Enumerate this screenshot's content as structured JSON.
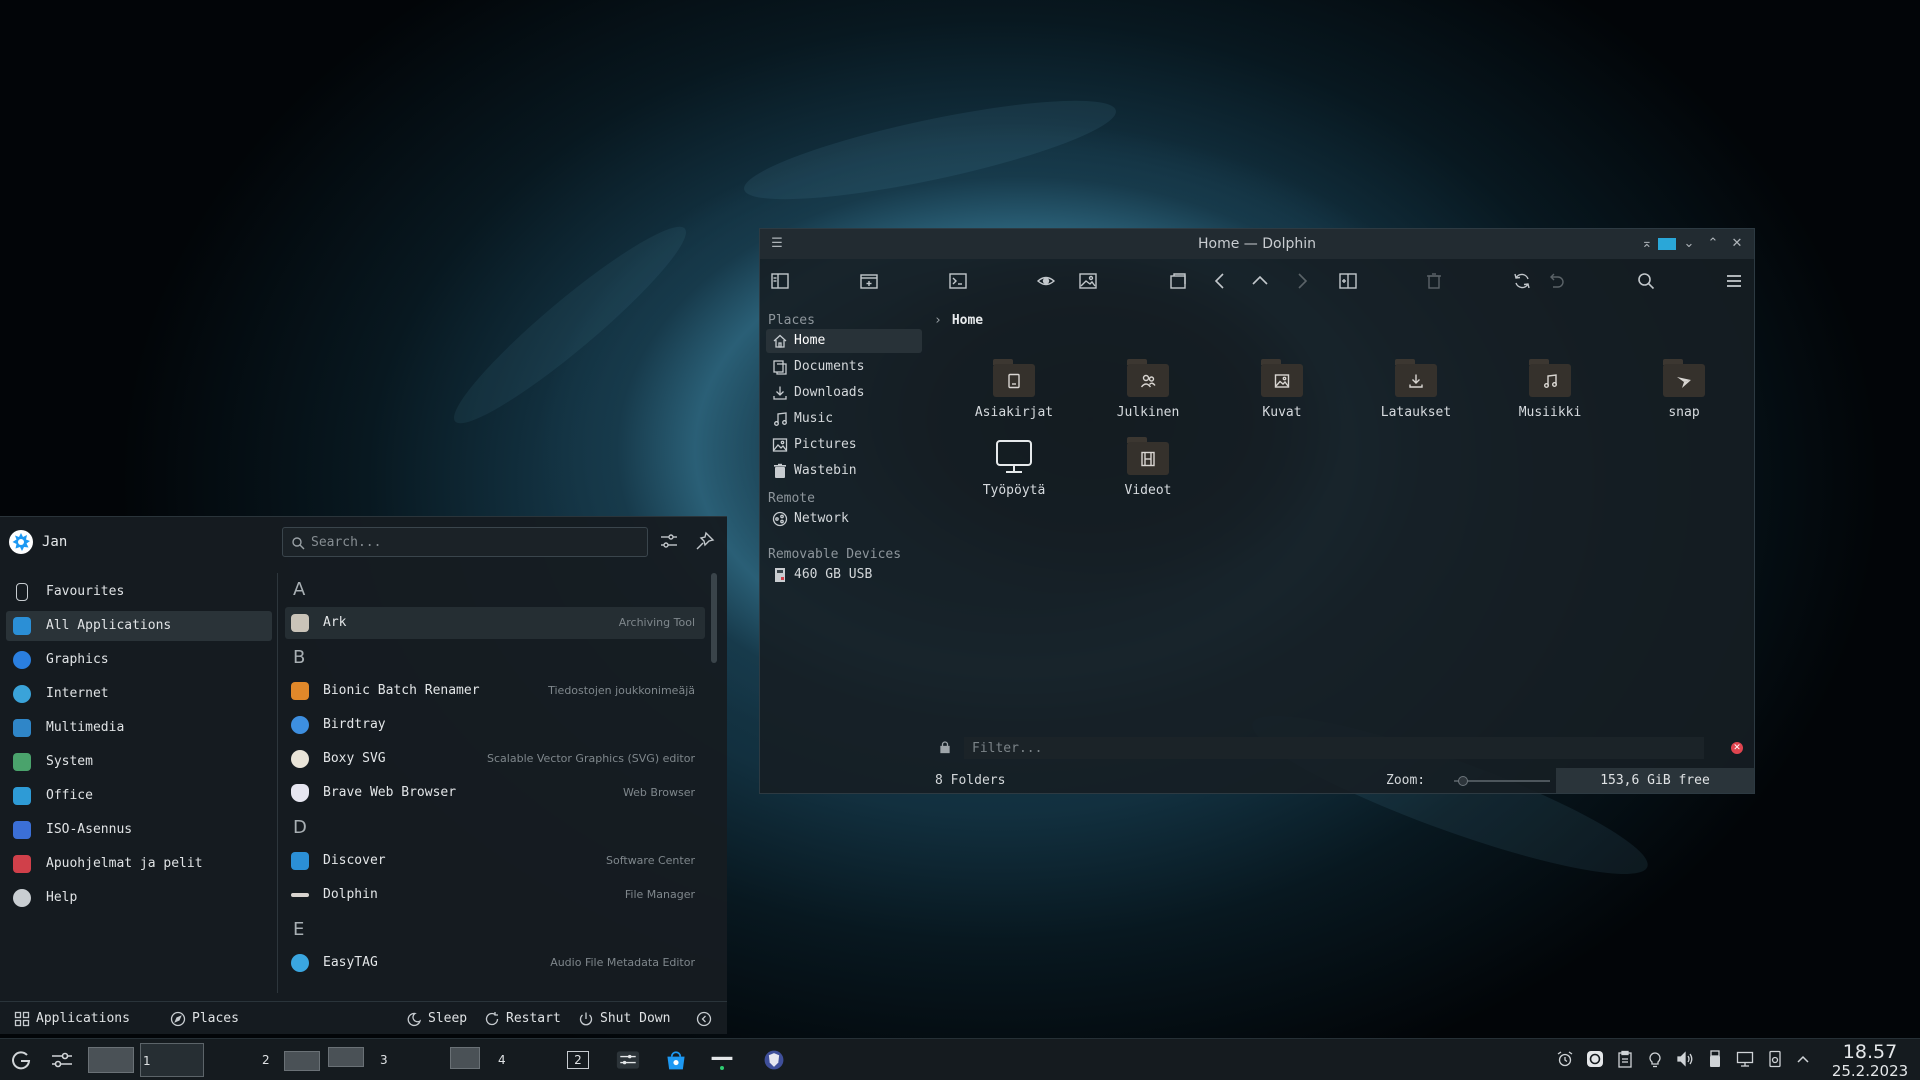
{
  "dolphin": {
    "title": "Home — Dolphin",
    "breadcrumb": "Home",
    "places_heading": "Places",
    "places": [
      {
        "label": "Home",
        "icon": "home-icon",
        "active": true
      },
      {
        "label": "Documents",
        "icon": "document-icon"
      },
      {
        "label": "Downloads",
        "icon": "download-icon"
      },
      {
        "label": "Music",
        "icon": "music-icon"
      },
      {
        "label": "Pictures",
        "icon": "image-icon"
      },
      {
        "label": "Wastebin",
        "icon": "trash-icon"
      }
    ],
    "remote_heading": "Remote",
    "remote": [
      {
        "label": "Network",
        "icon": "network-icon"
      }
    ],
    "removable_heading": "Removable Devices",
    "removable": [
      {
        "label": "460 GB USB",
        "icon": "usb-drive-icon"
      }
    ],
    "folders": [
      {
        "name": "Asiakirjat",
        "icon": "document-icon"
      },
      {
        "name": "Julkinen",
        "icon": "people-icon"
      },
      {
        "name": "Kuvat",
        "icon": "image-icon"
      },
      {
        "name": "Lataukset",
        "icon": "download-icon"
      },
      {
        "name": "Musiikki",
        "icon": "music-icon"
      },
      {
        "name": "snap",
        "icon": "snap-icon"
      },
      {
        "name": "Työpöytä",
        "icon": "monitor-icon"
      },
      {
        "name": "Videot",
        "icon": "video-icon"
      }
    ],
    "filter_placeholder": "Filter...",
    "status_count": "8 Folders",
    "zoom_label": "Zoom:",
    "zoom_level": 0.05,
    "free_space": "153,6 GiB free"
  },
  "launcher": {
    "user": "Jan",
    "search_placeholder": "Search...",
    "categories": [
      {
        "label": "Favourites",
        "icon": "bookmark-icon",
        "color": "#3b4449"
      },
      {
        "label": "All Applications",
        "icon": "grid-icon",
        "color": "#2b8fd6",
        "active": true
      },
      {
        "label": "Graphics",
        "icon": "graphics-icon",
        "color": "#2a7fe0"
      },
      {
        "label": "Internet",
        "icon": "globe-icon",
        "color": "#3aa3d9"
      },
      {
        "label": "Multimedia",
        "icon": "multimedia-icon",
        "color": "#2f86c8"
      },
      {
        "label": "System",
        "icon": "system-icon",
        "color": "#4aa36c"
      },
      {
        "label": "Office",
        "icon": "office-icon",
        "color": "#2e9bd6"
      },
      {
        "label": "ISO-Asennus",
        "icon": "installer-icon",
        "color": "#3b6fd6"
      },
      {
        "label": "Apuohjelmat ja pelit",
        "icon": "toolbox-icon",
        "color": "#d0404a"
      },
      {
        "label": "Help",
        "icon": "help-icon",
        "color": "#c9ced2"
      }
    ],
    "letters": [
      "A",
      "B",
      "D",
      "E"
    ],
    "apps": [
      {
        "name": "Ark",
        "desc": "Archiving Tool",
        "color": "#c9c3b8"
      },
      {
        "name": "Bionic Batch Renamer",
        "desc": "Tiedostojen joukkonimeäjä",
        "color": "#e0882a"
      },
      {
        "name": "Birdtray",
        "desc": "",
        "color": "#3d8fe0"
      },
      {
        "name": "Boxy SVG",
        "desc": "Scalable Vector Graphics (SVG) editor",
        "color": "#e9e4d8"
      },
      {
        "name": "Brave Web Browser",
        "desc": "Web Browser",
        "color": "#e6e6f0"
      },
      {
        "name": "Discover",
        "desc": "Software Center",
        "color": "#2b8fd6"
      },
      {
        "name": "Dolphin",
        "desc": "File Manager",
        "color": "#d8d4cf"
      },
      {
        "name": "EasyTAG",
        "desc": "Audio File Metadata Editor",
        "color": "#3aa6e0"
      }
    ],
    "footer": {
      "applications": "Applications",
      "places": "Places",
      "sleep": "Sleep",
      "restart": "Restart",
      "shutdown": "Shut Down"
    }
  },
  "taskbar": {
    "desktops": [
      "1",
      "2",
      "3",
      "4"
    ],
    "window_count": "2",
    "clock_time": "18.57",
    "clock_date": "25.2.2023"
  }
}
